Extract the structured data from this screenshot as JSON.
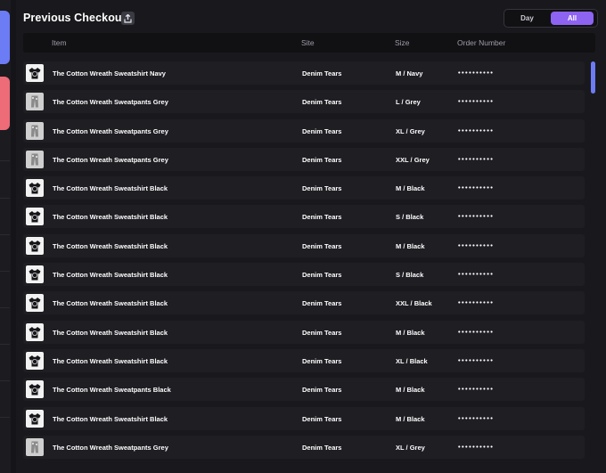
{
  "header": {
    "title": "Previous Checkouts",
    "export_icon": "export-icon"
  },
  "filter": {
    "day_label": "Day",
    "all_label": "All",
    "selected": "All"
  },
  "table": {
    "columns": {
      "item": "Item",
      "site": "Site",
      "size": "Size",
      "order": "Order Number"
    },
    "rows": [
      {
        "item": "The Cotton Wreath Sweatshirt Navy",
        "site": "Denim Tears",
        "size": "M / Navy",
        "order": "••••••••••",
        "thumb": "dark"
      },
      {
        "item": "The Cotton Wreath Sweatpants Grey",
        "site": "Denim Tears",
        "size": "L / Grey",
        "order": "••••••••••",
        "thumb": "grey"
      },
      {
        "item": "The Cotton Wreath Sweatpants Grey",
        "site": "Denim Tears",
        "size": "XL / Grey",
        "order": "••••••••••",
        "thumb": "grey"
      },
      {
        "item": "The Cotton Wreath Sweatpants Grey",
        "site": "Denim Tears",
        "size": "XXL / Grey",
        "order": "••••••••••",
        "thumb": "grey"
      },
      {
        "item": "The Cotton Wreath Sweatshirt Black",
        "site": "Denim Tears",
        "size": "M / Black",
        "order": "••••••••••",
        "thumb": "dark"
      },
      {
        "item": "The Cotton Wreath Sweatshirt Black",
        "site": "Denim Tears",
        "size": "S / Black",
        "order": "••••••••••",
        "thumb": "dark"
      },
      {
        "item": "The Cotton Wreath Sweatshirt Black",
        "site": "Denim Tears",
        "size": "M / Black",
        "order": "••••••••••",
        "thumb": "dark"
      },
      {
        "item": "The Cotton Wreath Sweatshirt Black",
        "site": "Denim Tears",
        "size": "S / Black",
        "order": "••••••••••",
        "thumb": "dark"
      },
      {
        "item": "The Cotton Wreath Sweatshirt Black",
        "site": "Denim Tears",
        "size": "XXL / Black",
        "order": "••••••••••",
        "thumb": "dark"
      },
      {
        "item": "The Cotton Wreath Sweatshirt Black",
        "site": "Denim Tears",
        "size": "M / Black",
        "order": "••••••••••",
        "thumb": "dark"
      },
      {
        "item": "The Cotton Wreath Sweatshirt Black",
        "site": "Denim Tears",
        "size": "XL / Black",
        "order": "••••••••••",
        "thumb": "dark"
      },
      {
        "item": "The Cotton Wreath Sweatpants Black",
        "site": "Denim Tears",
        "size": "M / Black",
        "order": "••••••••••",
        "thumb": "dark"
      },
      {
        "item": "The Cotton Wreath Sweatshirt Black",
        "site": "Denim Tears",
        "size": "M / Black",
        "order": "••••••••••",
        "thumb": "dark"
      },
      {
        "item": "The Cotton Wreath Sweatpants Grey",
        "site": "Denim Tears",
        "size": "XL / Grey",
        "order": "••••••••••",
        "thumb": "grey"
      }
    ]
  },
  "colors": {
    "accent": "#8d63f2",
    "rail_blue": "#6c7cf5",
    "rail_red": "#ee6b78",
    "background": "#19191d"
  }
}
